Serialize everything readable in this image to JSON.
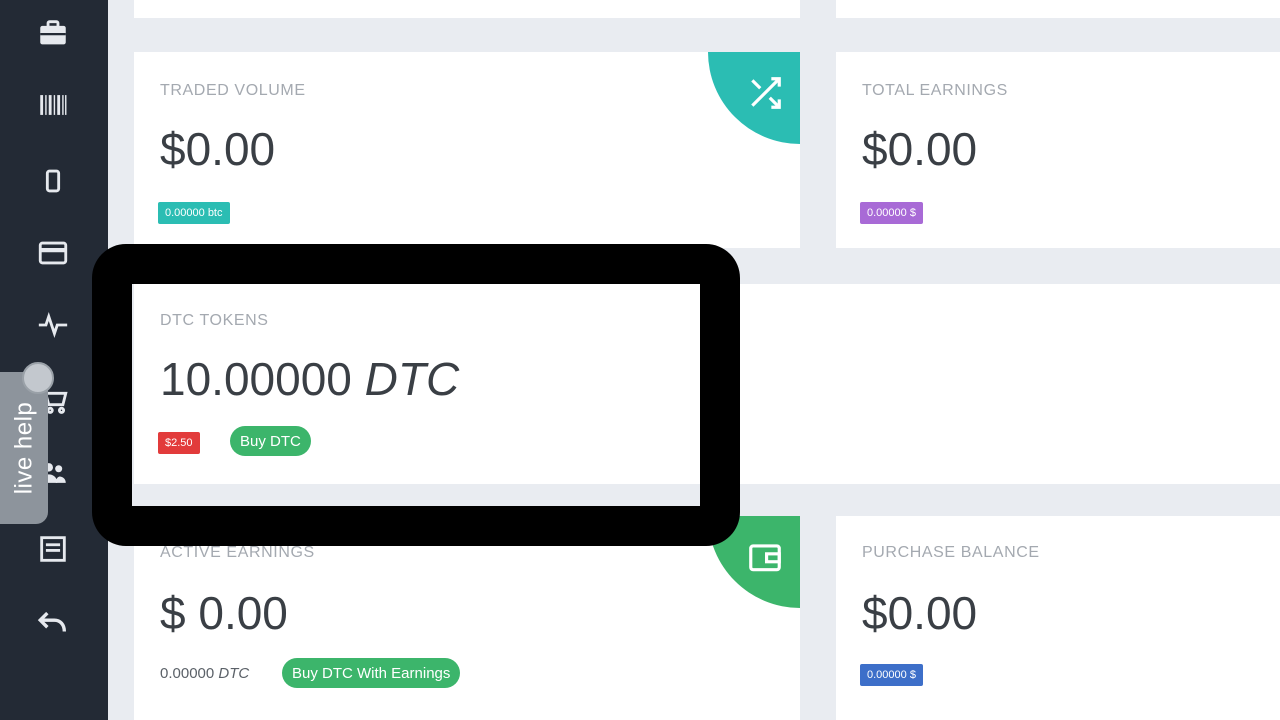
{
  "sidebar": {
    "icons": [
      "briefcase-icon",
      "barcode-icon",
      "mobile-icon",
      "credit-card-icon",
      "activity-icon",
      "cart-icon",
      "users-icon",
      "document-icon",
      "undo-icon"
    ]
  },
  "live_help": {
    "label": "live help"
  },
  "cards": {
    "traded_volume": {
      "label": "TRADED VOLUME",
      "value": "$0.00",
      "badge": "0.00000 btc",
      "badge_color": "#2bbdb3",
      "corner_color": "#2bbdb3",
      "corner_icon": "shuffle-icon"
    },
    "total_earnings": {
      "label": "TOTAL EARNINGS",
      "value": "$0.00",
      "badge": "0.00000 $",
      "badge_color": "#a86ad6"
    },
    "dtc_tokens": {
      "label": "DTC TOKENS",
      "value_number": "10.00000",
      "value_unit": "DTC",
      "badge": "$2.50",
      "badge_color": "#e23b3b",
      "button": "Buy DTC"
    },
    "active_earnings": {
      "label": "ACTIVE EARNINGS",
      "value": "$ 0.00",
      "sub_number": "0.00000",
      "sub_unit": "DTC",
      "button": "Buy DTC With Earnings",
      "corner_color": "#3cb56b",
      "corner_icon": "wallet-icon"
    },
    "purchase_balance": {
      "label": "PURCHASE BALANCE",
      "value": "$0.00",
      "badge": "0.00000 $",
      "badge_color": "#3d6fc9"
    }
  },
  "colors": {
    "sidebar": "#232a35",
    "page_bg": "#e9ecf1",
    "highlight": "#000000",
    "green": "#3cb56b"
  }
}
